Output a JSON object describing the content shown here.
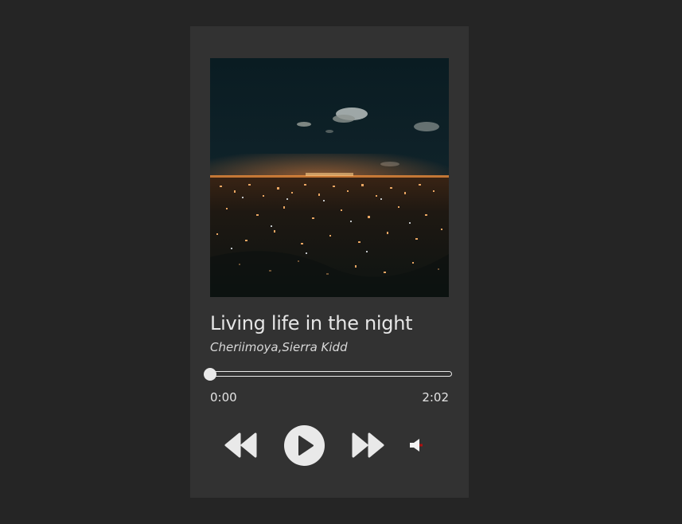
{
  "track": {
    "title": "Living life in the night",
    "artist": "Cheriimoya,Sierra Kidd"
  },
  "cover": {
    "description_icon": "album-cover-image"
  },
  "progress": {
    "current_time": "0:00",
    "total_time": "2:02",
    "fraction": 0
  },
  "controls": {
    "prev_icon": "rewind-icon",
    "play_icon": "play-icon",
    "next_icon": "fast-forward-icon",
    "volume_icon": "volume-icon"
  },
  "colors": {
    "page_background": "#252525",
    "player_background": "#323232",
    "foreground": "#e9e9e9",
    "volume_accent": "#b01010"
  }
}
